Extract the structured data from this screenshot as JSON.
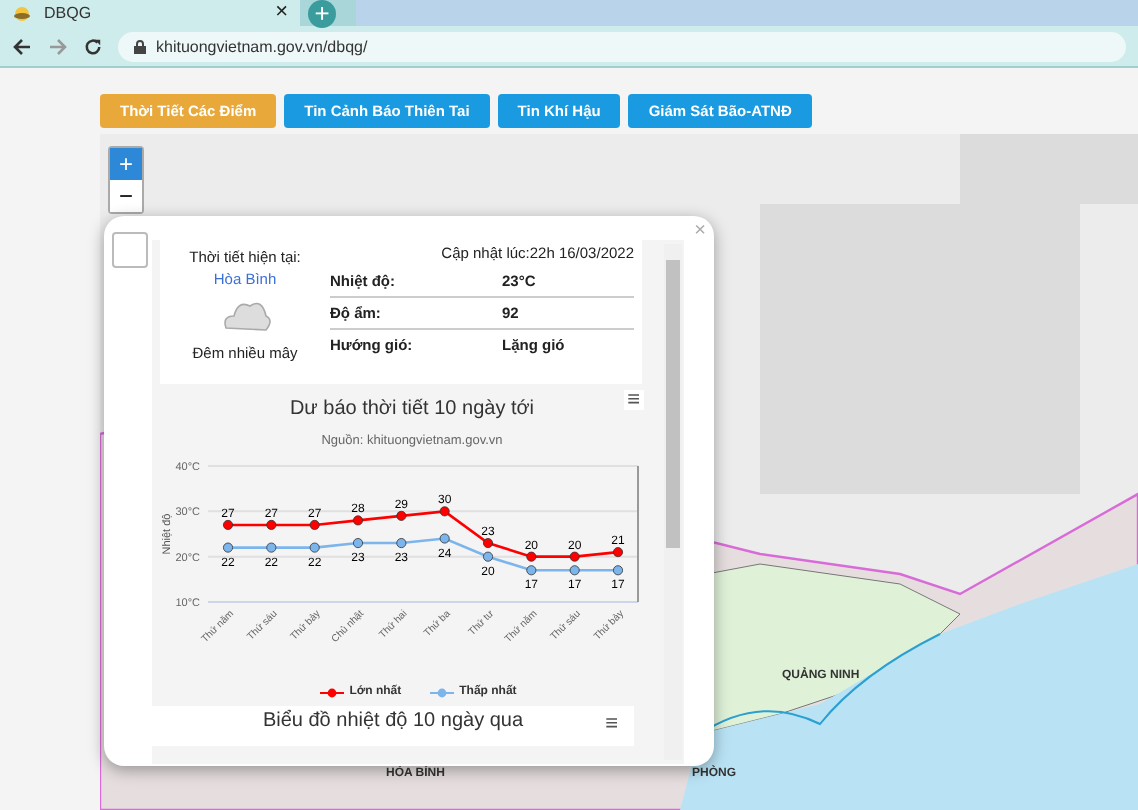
{
  "browser": {
    "tab_title": "DBQG",
    "tab_close": "×",
    "new_tab": "+",
    "address": "khituongvietnam.gov.vn/dbqg/"
  },
  "nav_buttons": [
    {
      "label": "Thời Tiết Các Điểm",
      "selected": true
    },
    {
      "label": "Tin Cảnh Báo Thiên Tai",
      "selected": false
    },
    {
      "label": "Tin Khí Hậu",
      "selected": false
    },
    {
      "label": "Giám Sát Bão-ATNĐ",
      "selected": false
    }
  ],
  "map": {
    "zoom_in": "+",
    "zoom_out": "−",
    "labels": [
      "QUẢNG NINH",
      "HÒA BÌNH",
      "PHÒNG"
    ]
  },
  "popup": {
    "close": "×",
    "current": {
      "heading": "Thời tiết hiện tại:",
      "place": "Hòa Bình",
      "condition": "Đêm nhiều mây"
    },
    "updated": "Cập nhật lúc:22h 16/03/2022",
    "rows": [
      {
        "label": "Nhiệt độ:",
        "value": "23°C"
      },
      {
        "label": "Độ ẩm:",
        "value": "92"
      },
      {
        "label": "Hướng gió:",
        "value": "Lặng gió"
      }
    ],
    "forecast": {
      "subtitle": "Nguồn: khituongvietnam.gov.vn",
      "menu": "≡",
      "chart_data": {
        "type": "line",
        "title": "Dư báo thời tiết 10 ngày tới",
        "ylabel": "Nhiệt độ",
        "categories": [
          "Thứ năm",
          "Thứ sáu",
          "Thứ bảy",
          "Chủ nhật",
          "Thứ hai",
          "Thứ ba",
          "Thứ tư",
          "Thứ năm",
          "Thứ sáu",
          "Thứ bảy"
        ],
        "series": [
          {
            "name": "Lớn nhất",
            "color": "#ff0000",
            "marker": true,
            "values": [
              27,
              27,
              27,
              28,
              29,
              30,
              23,
              20,
              20,
              21
            ]
          },
          {
            "name": "Thấp nhất",
            "color": "#7cb5ec",
            "marker": true,
            "values": [
              22,
              22,
              22,
              23,
              23,
              24,
              20,
              17,
              17,
              17
            ]
          }
        ],
        "legend": true,
        "ylim": [
          10,
          40
        ],
        "yticks": [
          {
            "value": 10,
            "label": "10°C"
          },
          {
            "value": 20,
            "label": "20°C"
          },
          {
            "value": 30,
            "label": "30°C"
          },
          {
            "value": 40,
            "label": "40°C"
          }
        ],
        "data_labels": true
      }
    },
    "past_chart": {
      "title": "Biểu đồ nhiệt độ 10 ngày qua",
      "menu": "≡"
    }
  }
}
